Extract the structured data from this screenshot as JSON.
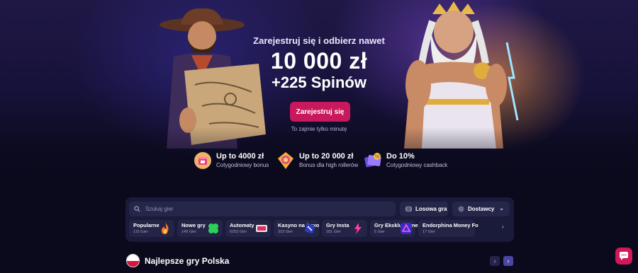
{
  "hero": {
    "subtitle": "Zarejestruj się i odbierz nawet",
    "amount": "10 000 zł",
    "spins": "+225 Spinów",
    "cta_label": "Zarejestruj się",
    "note": "To zajmie tylko minutę"
  },
  "perks": [
    {
      "title": "Up to 4000 zł",
      "subtitle": "Cotygodniowy bonus",
      "icon": "gift-calendar-icon"
    },
    {
      "title": "Up to 20 000 zł",
      "subtitle": "Bonus dla high rollerów",
      "icon": "medal-icon"
    },
    {
      "title": "Do 10%",
      "subtitle": "Cotygodniowy cashback",
      "icon": "cashback-icon"
    }
  ],
  "search": {
    "placeholder": "Szukaj gier",
    "random_label": "Losowa gra",
    "providers_label": "Dostawcy"
  },
  "categories": [
    {
      "name": "Popularne",
      "count": "115 Gier",
      "icon": "fire-icon"
    },
    {
      "name": "Nowe gry",
      "count": "149 Gier",
      "icon": "clover-icon"
    },
    {
      "name": "Automaty",
      "count": "6253 Gier",
      "icon": "slot-icon"
    },
    {
      "name": "Kasyno na żywo",
      "count": "323 Gier",
      "icon": "dice-icon"
    },
    {
      "name": "Gry Insta",
      "count": "181 Gier",
      "icon": "lightning-icon"
    },
    {
      "name": "Gry Ekskluzywne",
      "count": "5 Gier",
      "icon": "exclusive-icon"
    },
    {
      "name": "Endorphina Money Fo",
      "count": "17 Gier",
      "icon": "money-icon"
    }
  ],
  "section": {
    "title": "Najlepsze gry Polska"
  },
  "colors": {
    "accent": "#c8195c",
    "panel": "#1a1a3a",
    "next_button": "#4a46a6"
  }
}
